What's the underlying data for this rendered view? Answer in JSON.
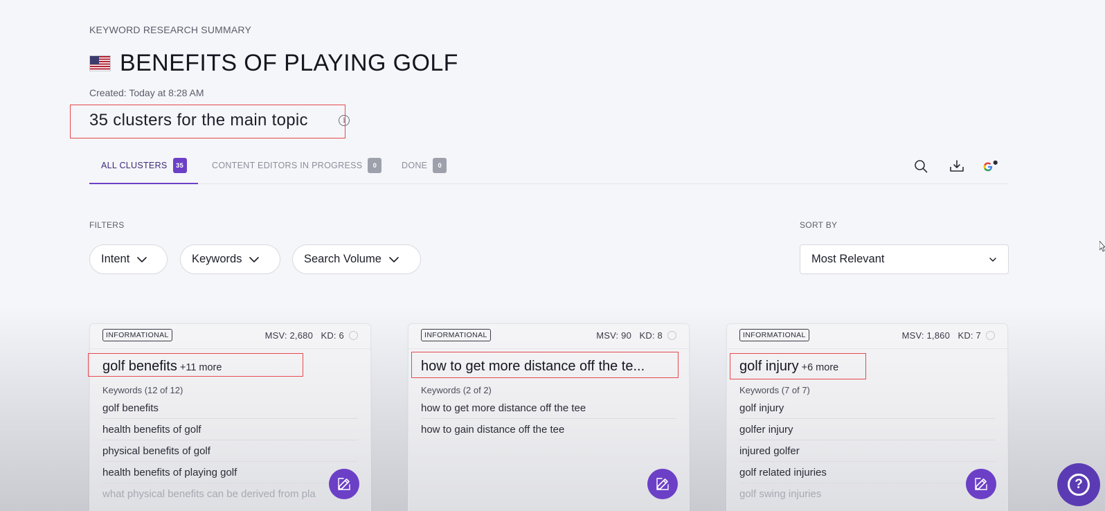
{
  "header": {
    "subtitle": "KEYWORD RESEARCH SUMMARY",
    "title": "BENEFITS OF PLAYING GOLF",
    "flag_icon": "us-flag-icon",
    "created": "Created: Today at 8:28 AM",
    "clusters_summary": "35 clusters for the main topic",
    "info_icon": "info-icon"
  },
  "tabs": [
    {
      "label": "ALL CLUSTERS",
      "count": "35",
      "active": true
    },
    {
      "label": "CONTENT EDITORS IN PROGRESS",
      "count": "0",
      "active": false
    },
    {
      "label": "DONE",
      "count": "0",
      "active": false
    }
  ],
  "toolbar": {
    "icons": [
      "search-icon",
      "download-icon",
      "google-icon"
    ]
  },
  "filters": {
    "label": "FILTERS",
    "buttons": [
      "Intent",
      "Keywords",
      "Search Volume"
    ]
  },
  "sort": {
    "label": "SORT BY",
    "selected": "Most Relevant"
  },
  "cards": [
    {
      "intent": "INFORMATIONAL",
      "metrics": "MSV: 2,680   KD: 6",
      "name": "golf benefits",
      "more": "+11 more",
      "keywords_count": "Keywords (12 of 12)",
      "keywords": [
        "golf benefits",
        "health benefits of golf",
        "physical benefits of golf",
        "health benefits of playing golf",
        "what physical benefits can be derived from pla"
      ]
    },
    {
      "intent": "INFORMATIONAL",
      "metrics": "MSV: 90   KD: 8",
      "name": "how to get more distance off the te...",
      "more": "",
      "keywords_count": "Keywords (2 of 2)",
      "keywords": [
        "how to get more distance off the tee",
        "how to gain distance off the tee"
      ]
    },
    {
      "intent": "INFORMATIONAL",
      "metrics": "MSV: 1,860   KD: 7",
      "name": "golf injury",
      "more": "+6 more",
      "keywords_count": "Keywords (7 of 7)",
      "keywords": [
        "golf injury",
        "golfer injury",
        "injured golfer",
        "golf related injuries",
        "golf swing injuries"
      ]
    }
  ],
  "colors": {
    "accent": "#6c3fc7",
    "highlight_box": "#e5484d",
    "background": "#f5f6f9"
  }
}
